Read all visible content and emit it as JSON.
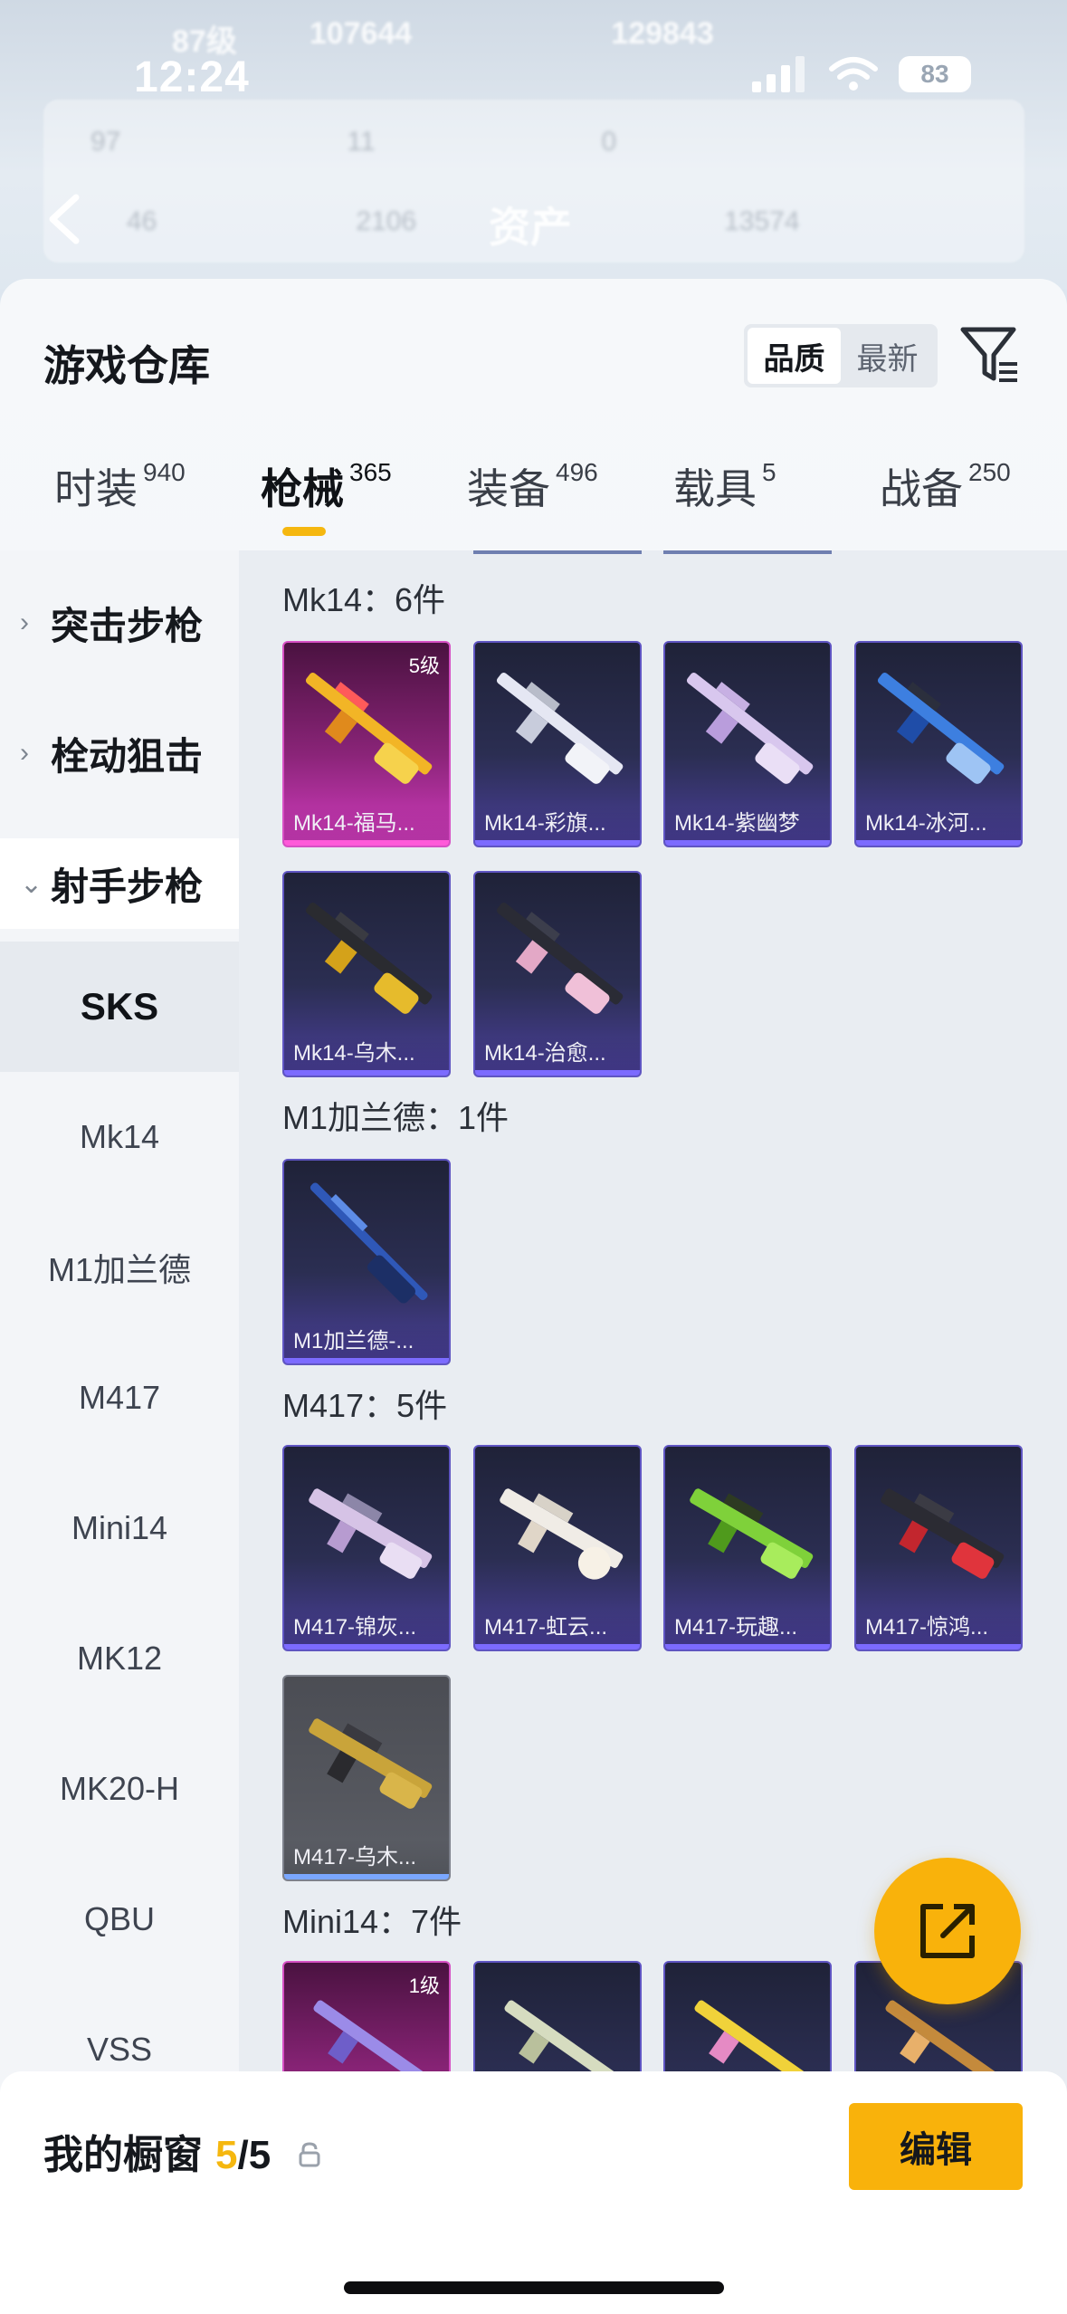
{
  "status_bar": {
    "time": "12:24",
    "battery": "83"
  },
  "background_header": {
    "level": "87级",
    "stat_a": "107644",
    "stat_b": "129843",
    "row1": [
      "97",
      "11",
      "0"
    ],
    "row2": [
      "46",
      "2106",
      "13574"
    ],
    "title": "资产"
  },
  "sheet": {
    "title": "游戏仓库",
    "sort_options": [
      "品质",
      "最新"
    ],
    "sort_active": "品质"
  },
  "tabs": [
    {
      "name": "时装",
      "count": "940"
    },
    {
      "name": "枪械",
      "count": "365"
    },
    {
      "name": "装备",
      "count": "496"
    },
    {
      "name": "载具",
      "count": "5"
    },
    {
      "name": "战备",
      "count": "250"
    }
  ],
  "sidenav": {
    "categories": [
      "突击步枪",
      "栓动狙击",
      "射手步枪"
    ],
    "subs": [
      "SKS",
      "Mk14",
      "M1加兰德",
      "M417",
      "Mini14",
      "MK12",
      "MK20-H",
      "QBU",
      "VSS"
    ]
  },
  "groups": [
    {
      "title": "Mk14：6件",
      "items": [
        {
          "name": "Mk14-福马...",
          "level": "5级"
        },
        {
          "name": "Mk14-彩旗..."
        },
        {
          "name": "Mk14-紫幽梦"
        },
        {
          "name": "Mk14-冰河..."
        },
        {
          "name": "Mk14-乌木..."
        },
        {
          "name": "Mk14-治愈..."
        }
      ]
    },
    {
      "title": "M1加兰德：1件",
      "items": [
        {
          "name": "M1加兰德-..."
        }
      ]
    },
    {
      "title": "M417：5件",
      "items": [
        {
          "name": "M417-锦灰..."
        },
        {
          "name": "M417-虹云..."
        },
        {
          "name": "M417-玩趣..."
        },
        {
          "name": "M417-惊鸿..."
        },
        {
          "name": "M417-乌木..."
        }
      ]
    },
    {
      "title": "Mini14：7件",
      "items": [
        {
          "level": "1级"
        }
      ]
    }
  ],
  "bottom_bar": {
    "label": "我的橱窗",
    "current": "5",
    "total": "/5",
    "edit": "编辑"
  },
  "colors": {
    "accent": "#f9b20b",
    "epic": "#5f55c2",
    "legendary": "#d650c4"
  }
}
